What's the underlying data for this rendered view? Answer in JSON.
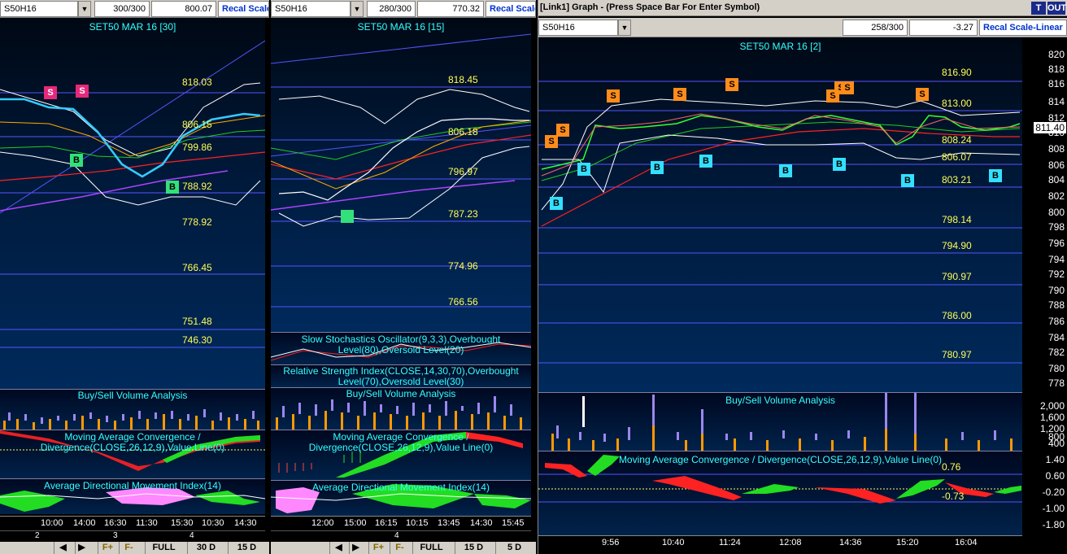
{
  "panel1": {
    "symbol": "S50H16",
    "range": "300/300",
    "last": "800.07",
    "recal": "Recal Scale",
    "title": "SET50 MAR 16  [30]",
    "levels": [
      "818.03",
      "806.15",
      "799.86",
      "788.92",
      "778.92",
      "766.45",
      "751.48",
      "746.30"
    ],
    "signals": {
      "s": "S",
      "b": "B"
    },
    "volume_label": "Buy/Sell Volume Analysis",
    "macd_label": "Moving Average Convergence / Divergence(CLOSE,26,12,9),Value Line(0)",
    "adx_label": "Average Directional Movement Index(14)",
    "times": [
      "10:00",
      "14:00",
      "16:30",
      "11:30",
      "15:30",
      "10:30",
      "14:30"
    ],
    "days": [
      "2",
      "3",
      "4"
    ],
    "nav": [
      "F+",
      "F-",
      "FULL",
      "30 D",
      "15 D"
    ]
  },
  "panel2": {
    "symbol": "S50H16",
    "range": "280/300",
    "last": "770.32",
    "recal": "Recal Scale",
    "title": "SET50 MAR 16  [15]",
    "levels": [
      "818.45",
      "806.18",
      "796.97",
      "787.23",
      "774.96",
      "766.56"
    ],
    "stoch_label": "Slow Stochastics Oscillator(9,3,3),Overbought Level(80),Oversold Level(20)",
    "rsi_label": "Relative Strength Index(CLOSE,14,30,70),Overbought Level(70),Oversold Level(30)",
    "volume_label": "Buy/Sell Volume Analysis",
    "macd_label": "Moving Average Convergence / Divergence(CLOSE,26,12,9),Value Line(0)",
    "adx_label": "Average Directional Movement Index(14)",
    "times": [
      "12:00",
      "15:00",
      "16:15",
      "10:15",
      "13:45",
      "14:30",
      "15:45"
    ],
    "days": [
      "4"
    ],
    "nav": [
      "F+",
      "F-",
      "FULL",
      "15 D",
      "5 D"
    ]
  },
  "panel3": {
    "window_title": "[Link1] Graph  - (Press Space Bar For Enter Symbol)",
    "btn_t": "T",
    "btn_out": "OUT",
    "symbol": "S50H16",
    "range": "258/300",
    "change": "-3.27",
    "recal": "Recal Scale-Linear",
    "title": "SET50 MAR 16  [2]",
    "levels": [
      "816.90",
      "813.00",
      "808.24",
      "806.07",
      "803.21",
      "798.14",
      "794.90",
      "790.97",
      "786.00",
      "780.97"
    ],
    "last_price": "811.40",
    "yaxis": [
      "820",
      "818",
      "816",
      "814",
      "812",
      "810",
      "808",
      "806",
      "804",
      "802",
      "800",
      "798",
      "796",
      "794",
      "792",
      "790",
      "788",
      "786",
      "784",
      "782",
      "780",
      "778"
    ],
    "volume_label": "Buy/Sell Volume Analysis",
    "vol_axis": [
      "2,000",
      "1,600",
      "1,200",
      "800",
      "400"
    ],
    "macd_label": "Moving Average Convergence / Divergence(CLOSE,26,12,9),Value Line(0)",
    "macd_levels": [
      "0.76",
      "-0.73"
    ],
    "macd_axis": [
      "1.40",
      "0.60",
      "-0.20",
      "-1.00",
      "-1.80"
    ],
    "times": [
      "9:56",
      "10:40",
      "11:24",
      "12:08",
      "14:36",
      "15:20",
      "16:04"
    ]
  },
  "colors": {
    "title": "#33ffff",
    "level": "#ffff55",
    "sell_pink": "#e6297a",
    "sell_orange": "#ff8c1a",
    "buy_green": "#33e07a",
    "buy_cyan": "#33e0ff",
    "volume_buy": "#ff9900",
    "volume_sell": "#9988ee"
  }
}
